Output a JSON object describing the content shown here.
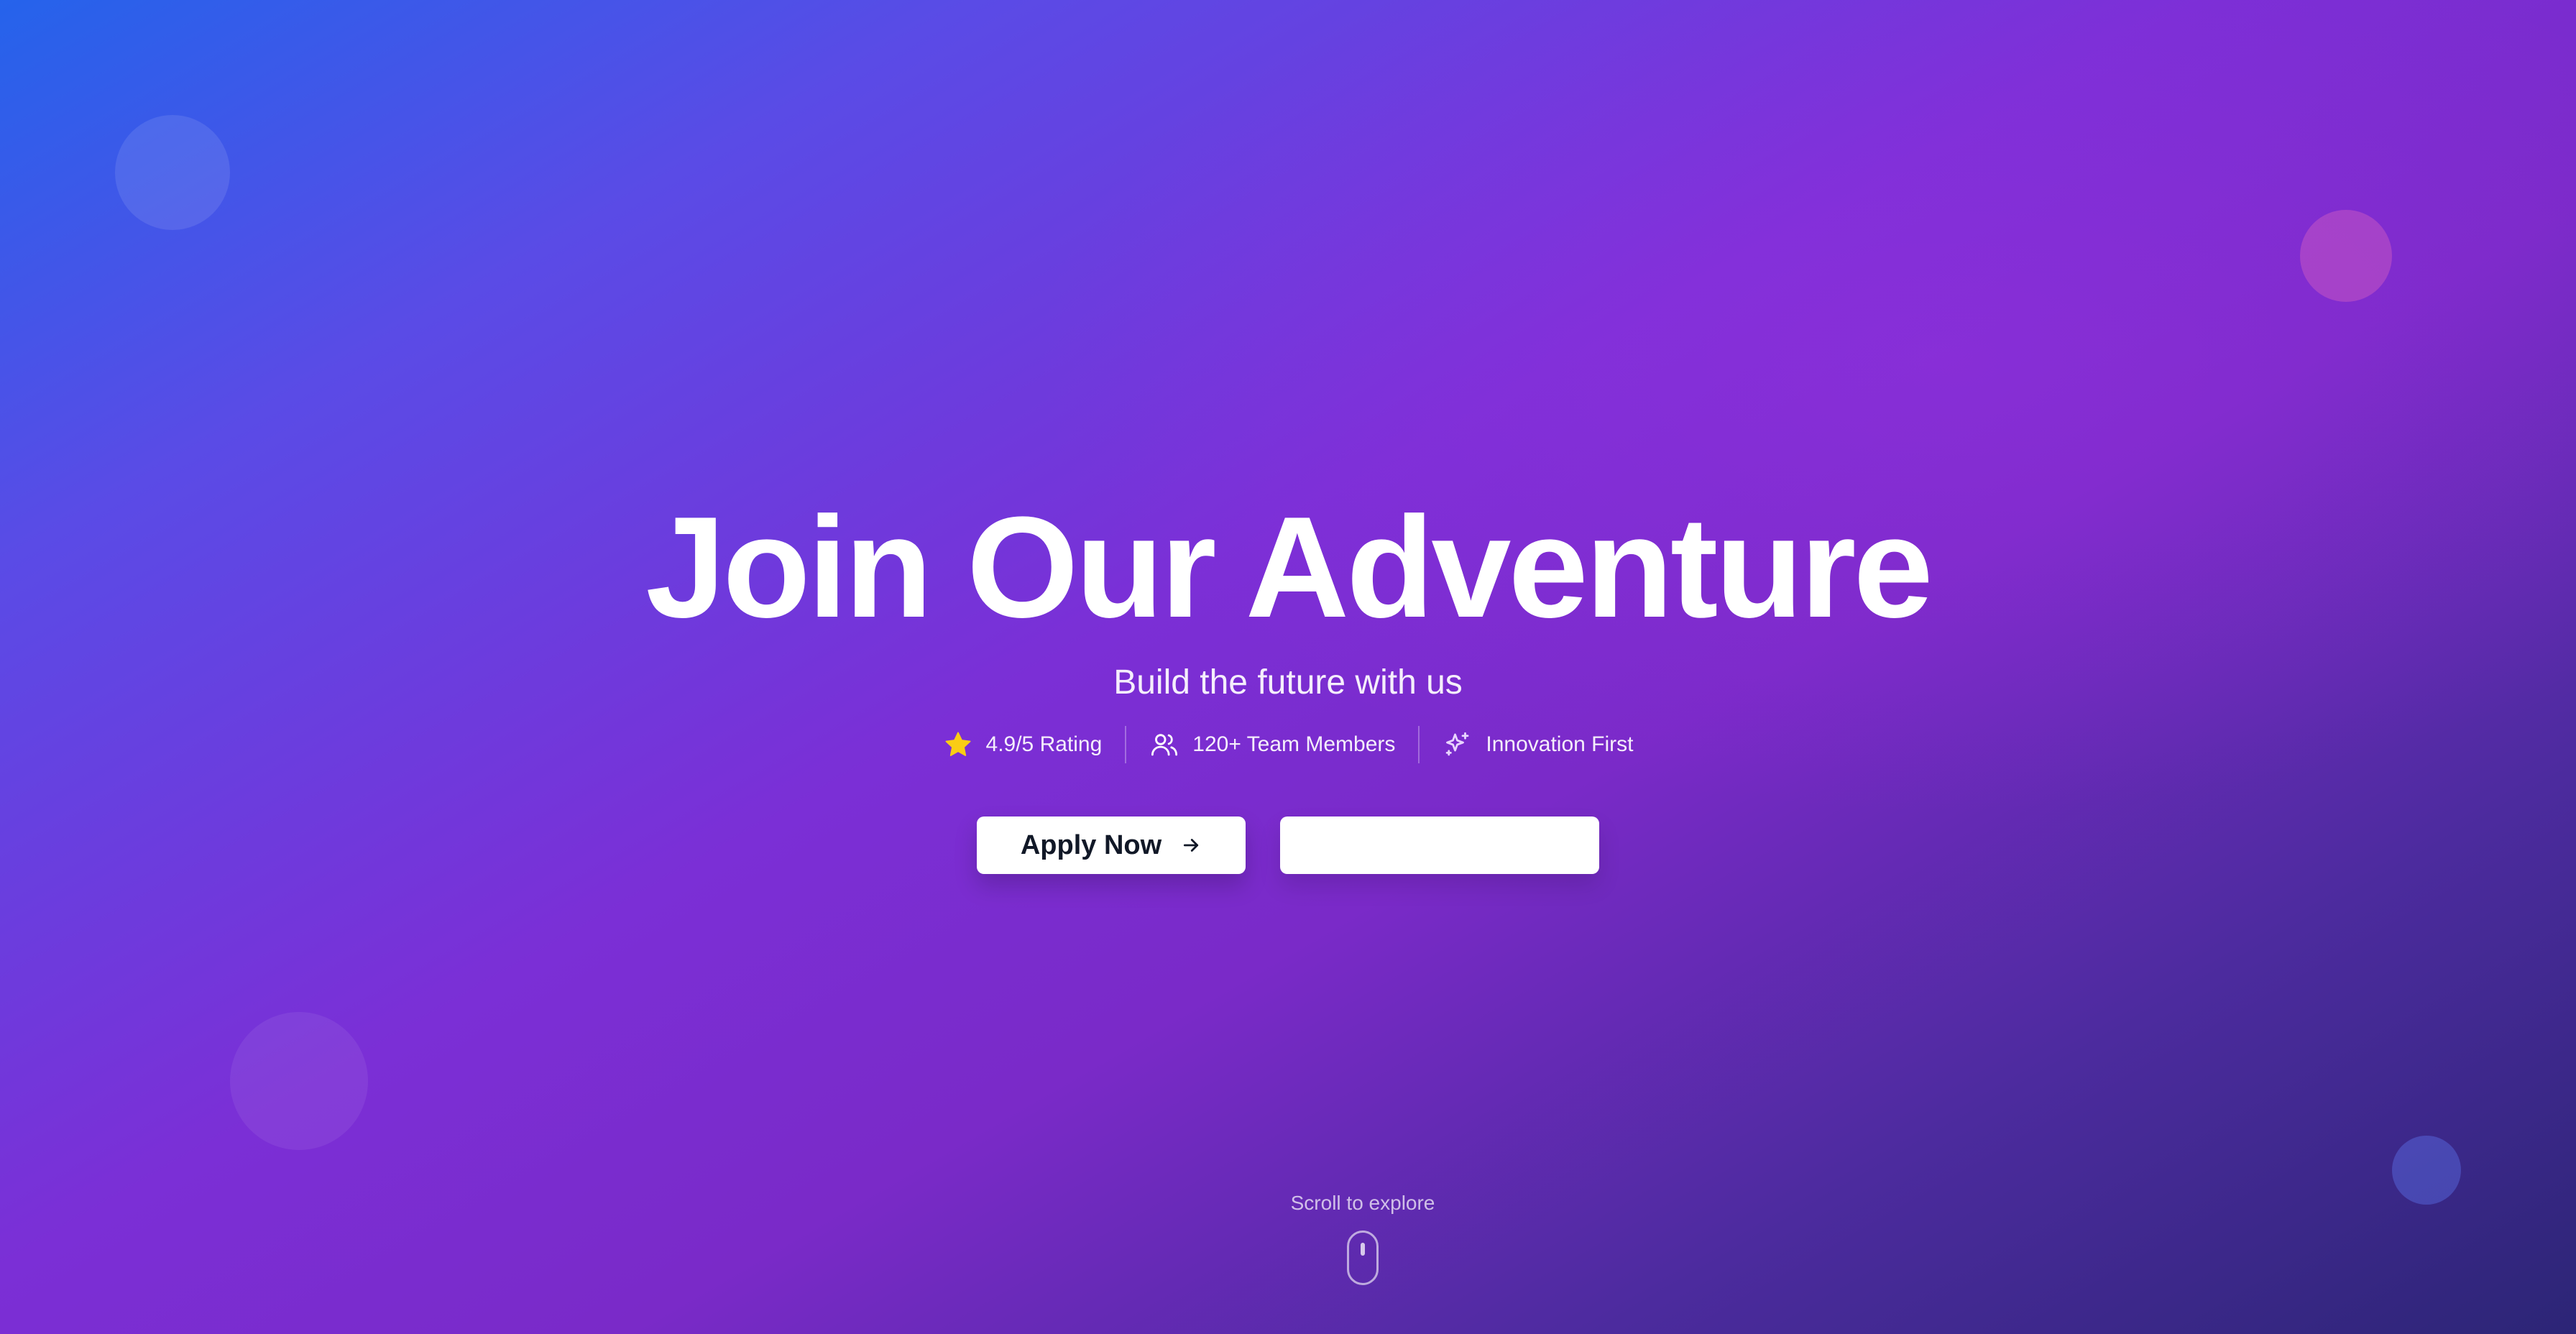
{
  "hero": {
    "title": "Join Our Adventure",
    "subtitle": "Build the future with us"
  },
  "stats": [
    {
      "icon": "star-icon",
      "label": "4.9/5 Rating"
    },
    {
      "icon": "users-icon",
      "label": "120+ Team Members"
    },
    {
      "icon": "sparkles-icon",
      "label": "Innovation First"
    }
  ],
  "actions": {
    "primary_label": "Apply Now",
    "primary_icon": "arrow-right-icon",
    "secondary_label": ""
  },
  "scroll": {
    "label": "Scroll to explore",
    "icon": "mouse-icon"
  },
  "colors": {
    "gradient_start": "#2563eb",
    "gradient_mid": "#7b2fd6",
    "gradient_end": "#2c2576",
    "star": "#facc15",
    "button_bg": "#ffffff",
    "button_text": "#111827"
  }
}
